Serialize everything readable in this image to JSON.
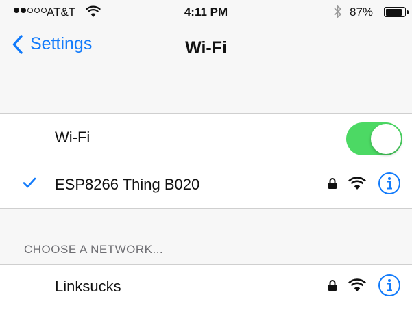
{
  "status_bar": {
    "carrier": "AT&T",
    "signal_bars_filled": 2,
    "signal_bars_total": 5,
    "time": "4:11 PM",
    "battery_percent": "87%",
    "battery_level": 0.87,
    "icons": [
      "wifi-icon",
      "bluetooth-icon",
      "battery-icon"
    ]
  },
  "nav": {
    "back_label": "Settings",
    "title": "Wi-Fi"
  },
  "wifi_toggle": {
    "label": "Wi-Fi",
    "on": true
  },
  "connected_network": {
    "name": "ESP8266 Thing B020",
    "secured": true
  },
  "choose_section": {
    "header": "CHOOSE A NETWORK...",
    "networks": [
      {
        "name": "Linksucks"
      }
    ]
  },
  "colors": {
    "accent": "#127bfb",
    "toggle_on": "#4cd964",
    "background": "#f7f7f7"
  }
}
